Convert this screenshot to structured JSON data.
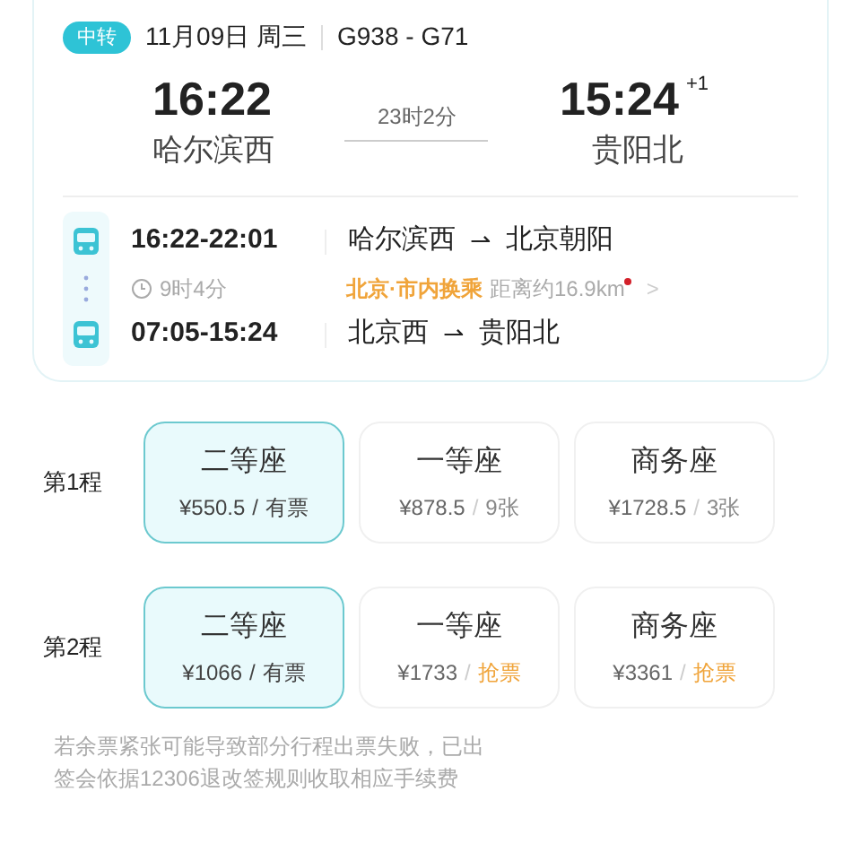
{
  "trip": {
    "badge": "中转",
    "date": "11月09日 周三",
    "trains": "G938 - G71",
    "depart_time": "16:22",
    "depart_station": "哈尔滨西",
    "duration": "23时2分",
    "arrive_time": "15:24",
    "arrive_day": "+1",
    "arrive_station": "贵阳北"
  },
  "segments": [
    {
      "kind": "train",
      "time": "16:22-22:01",
      "from": "哈尔滨西",
      "arrow": "⇀",
      "to": "北京朝阳"
    },
    {
      "kind": "transfer",
      "wait": "9时4分",
      "transfer": "北京·市内换乘",
      "distance": "距离约16.9km",
      "chevron": ">"
    },
    {
      "kind": "train",
      "time": "07:05-15:24",
      "from": "北京西",
      "arrow": "⇀",
      "to": "贵阳北"
    }
  ],
  "legs": [
    {
      "label": "第1程",
      "seats": [
        {
          "name": "二等座",
          "price": "¥550.5",
          "sep": "/",
          "avail": "有票",
          "selected": true,
          "grab": false
        },
        {
          "name": "一等座",
          "price": "¥878.5",
          "sep": "/",
          "avail": "9张",
          "selected": false,
          "grab": false
        },
        {
          "name": "商务座",
          "price": "¥1728.5",
          "sep": "/",
          "avail": "3张",
          "selected": false,
          "grab": false
        }
      ]
    },
    {
      "label": "第2程",
      "seats": [
        {
          "name": "二等座",
          "price": "¥1066",
          "sep": "/",
          "avail": "有票",
          "selected": true,
          "grab": false
        },
        {
          "name": "一等座",
          "price": "¥1733",
          "sep": "/",
          "avail": "抢票",
          "selected": false,
          "grab": true
        },
        {
          "name": "商务座",
          "price": "¥3361",
          "sep": "/",
          "avail": "抢票",
          "selected": false,
          "grab": true
        }
      ]
    }
  ],
  "notice": "若余票紧张可能导致部分行程出票失败，已出",
  "notice_2": "签会依据12306退改签规则收取相应手续费"
}
